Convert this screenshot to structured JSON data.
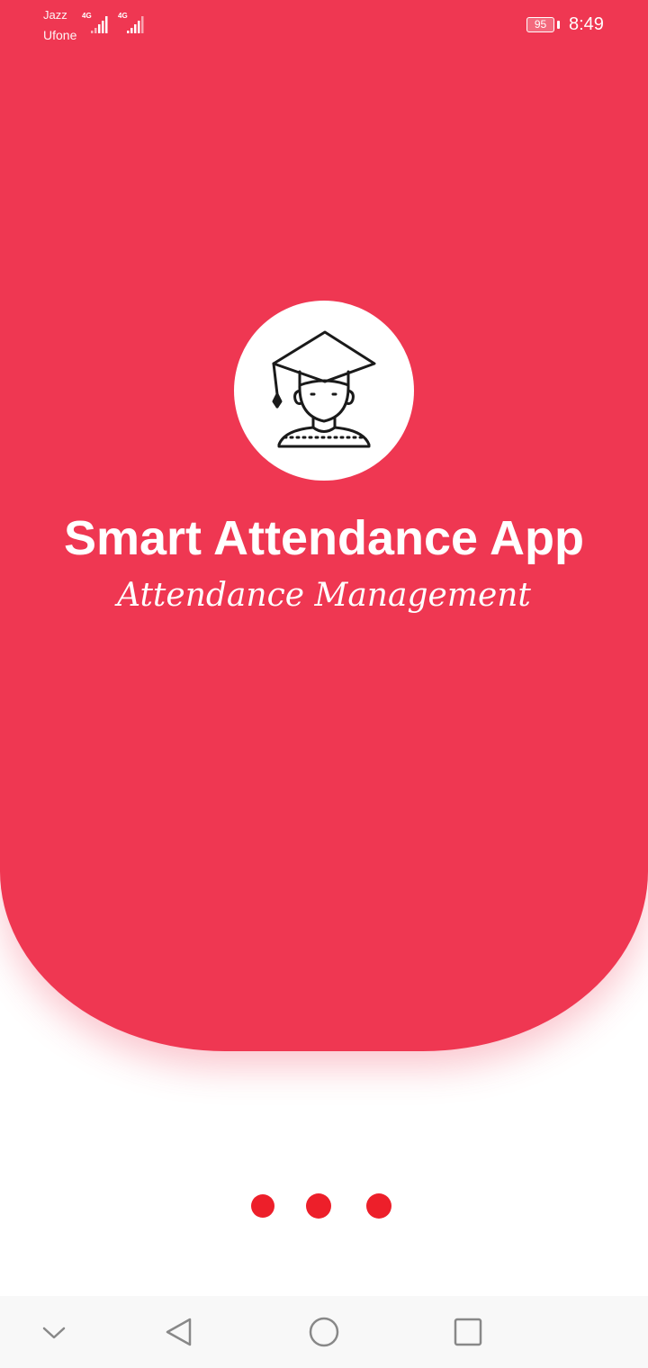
{
  "status_bar": {
    "carrier_1": "Jazz",
    "carrier_2": "Ufone",
    "network_1": "4G",
    "network_2": "4G",
    "battery": "95",
    "time": "8:49"
  },
  "splash": {
    "logo_icon": "graduate-student-icon",
    "title": "Smart Attendance App",
    "subtitle": "Attendance Management"
  },
  "page_indicator": {
    "count": 3
  },
  "nav_bar": {
    "icons": [
      "chevron-down-icon",
      "back-icon",
      "home-icon",
      "recents-icon"
    ]
  },
  "colors": {
    "primary": "#ef3752",
    "indicator": "#ed1f2a",
    "background": "#ffffff",
    "navbar": "#f8f8f8"
  }
}
